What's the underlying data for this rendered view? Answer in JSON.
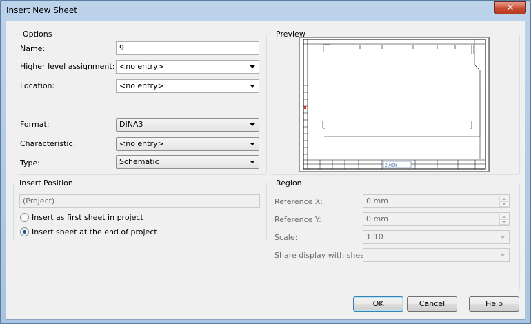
{
  "window": {
    "title": "Insert New Sheet",
    "close_glyph": "✕"
  },
  "options": {
    "group_label": "Options",
    "name_label": "Name:",
    "name_value": "9",
    "higher_label": "Higher level assignment:",
    "higher_value": "<no entry>",
    "location_label": "Location:",
    "location_value": "<no entry>",
    "format_label": "Format:",
    "format_value": "DINA3",
    "characteristic_label": "Characteristic:",
    "characteristic_value": "<no entry>",
    "type_label": "Type:",
    "type_value": "Schematic"
  },
  "preview": {
    "group_label": "Preview",
    "logo_text": "ZUKEN"
  },
  "insert_position": {
    "group_label": "Insert Position",
    "project_value": "(Project)",
    "first_label": "Insert as first sheet in project",
    "end_label": "Insert sheet at the end of project",
    "selected": "end"
  },
  "region": {
    "group_label": "Region",
    "ref_x_label": "Reference X:",
    "ref_x_value": "0 mm",
    "ref_y_label": "Reference Y:",
    "ref_y_value": "0 mm",
    "scale_label": "Scale:",
    "scale_value": "1:10",
    "share_label": "Share display with sheet:",
    "share_value": ""
  },
  "buttons": {
    "ok": "OK",
    "cancel": "Cancel",
    "help": "Help"
  },
  "colors": {
    "accent": "#3c7fb1",
    "close": "#c8492f"
  }
}
